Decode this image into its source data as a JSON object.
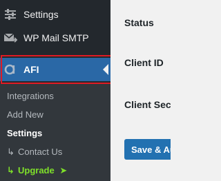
{
  "sidebar": {
    "items": [
      {
        "label": "Settings",
        "icon": "sliders-icon"
      },
      {
        "label": "WP Mail SMTP",
        "icon": "mail-arrow-icon"
      },
      {
        "label": "AFI",
        "icon": "afi-logo-icon"
      }
    ],
    "submenu": [
      {
        "label": "Integrations"
      },
      {
        "label": "Add New"
      },
      {
        "label": "Settings"
      },
      {
        "label": "Contact Us",
        "prefix": "↳"
      },
      {
        "label": "Upgrade",
        "prefix": "↳",
        "suffix": "➤"
      }
    ]
  },
  "content": {
    "labels": [
      "Status",
      "Client ID",
      "Client Sec"
    ],
    "save_button": "Save & Au"
  },
  "colors": {
    "sidebar_bg": "#23282d",
    "submenu_bg": "#32373c",
    "active_bg": "#2a68a6",
    "highlight": "#e01b24",
    "upgrade": "#7fe02a",
    "button": "#2271b1"
  }
}
